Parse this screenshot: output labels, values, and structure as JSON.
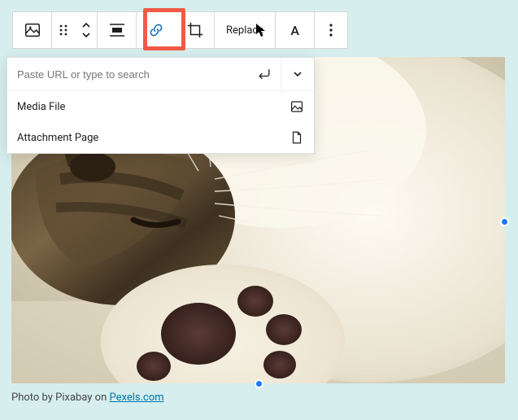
{
  "toolbar": {
    "replace_label": "Replace",
    "typography_label": "A"
  },
  "link_popover": {
    "placeholder": "Paste URL or type to search",
    "options": [
      {
        "label": "Media File",
        "icon": "image-file"
      },
      {
        "label": "Attachment Page",
        "icon": "page"
      }
    ]
  },
  "caption": {
    "prefix": "Photo by Pixabay on ",
    "link_text": "Pexels.com",
    "link_href": "#"
  }
}
